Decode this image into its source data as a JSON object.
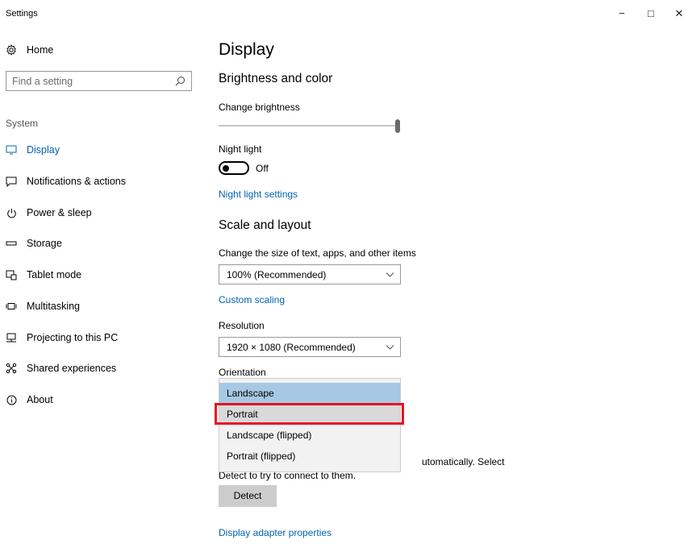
{
  "window": {
    "title": "Settings",
    "minimize_glyph": "−",
    "maximize_glyph": "□",
    "close_glyph": "✕"
  },
  "sidebar": {
    "home_label": "Home",
    "search_placeholder": "Find a setting",
    "section_label": "System",
    "items": [
      {
        "label": "Display",
        "icon": "monitor-icon",
        "active": true
      },
      {
        "label": "Notifications & actions",
        "icon": "notification-icon"
      },
      {
        "label": "Power & sleep",
        "icon": "power-icon"
      },
      {
        "label": "Storage",
        "icon": "storage-icon"
      },
      {
        "label": "Tablet mode",
        "icon": "tablet-icon"
      },
      {
        "label": "Multitasking",
        "icon": "multitasking-icon"
      },
      {
        "label": "Projecting to this PC",
        "icon": "projector-icon"
      },
      {
        "label": "Shared experiences",
        "icon": "share-icon"
      },
      {
        "label": "About",
        "icon": "info-icon"
      }
    ]
  },
  "main": {
    "title": "Display",
    "brightness_heading": "Brightness and color",
    "change_brightness_label": "Change brightness",
    "brightness_level": 1.0,
    "night_light_label": "Night light",
    "night_light_state": "Off",
    "night_light_settings_link": "Night light settings",
    "scale_heading": "Scale and layout",
    "scale_label": "Change the size of text, apps, and other items",
    "scale_value": "100% (Recommended)",
    "custom_scaling_link": "Custom scaling",
    "resolution_label": "Resolution",
    "resolution_value": "1920 × 1080 (Recommended)",
    "orientation_label": "Orientation",
    "orientation_options": [
      "Landscape",
      "Portrait",
      "Landscape (flipped)",
      "Portrait (flipped)"
    ],
    "orientation_selected": "Landscape",
    "orientation_hovered": "Portrait",
    "partial_text_1": "utomatically. Select",
    "partial_text_2": "Detect to try to connect to them.",
    "detect_button": "Detect",
    "adapter_link": "Display adapter properties"
  },
  "colors": {
    "accent": "#0063b1",
    "dropdown_selected": "#a6c8e4",
    "dropdown_hover": "#d9d9d9",
    "highlight": "#e81123"
  }
}
